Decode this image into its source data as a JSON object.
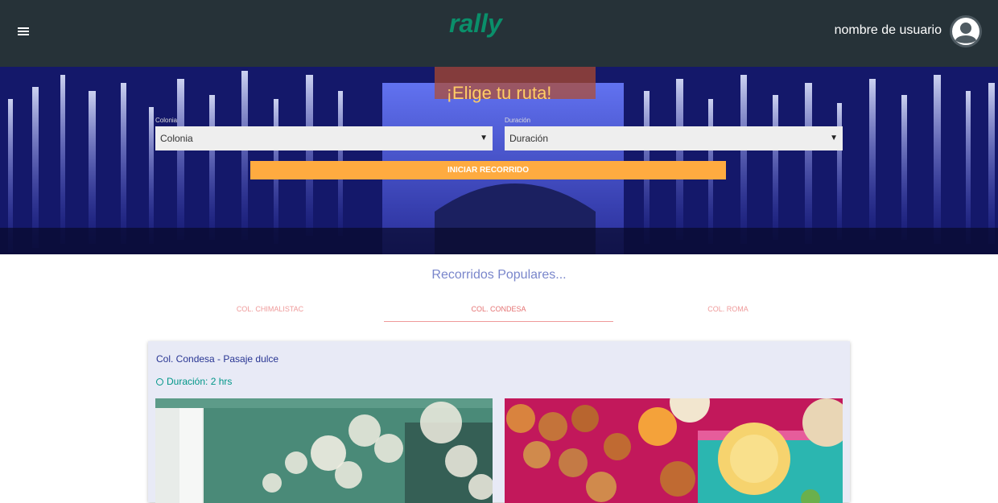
{
  "header": {
    "logo_text": "rally",
    "username": "nombre de usuario",
    "colors": {
      "bar": "#263238",
      "logo": "#0a8f6a"
    }
  },
  "hero": {
    "title": "¡Elige tu ruta!",
    "colonia": {
      "label": "Colonia",
      "value": "Colonia"
    },
    "duracion": {
      "label": "Duración",
      "value": "Duración"
    },
    "start_button": "INICIAR RECORRIDO",
    "colors": {
      "button": "#ffab40",
      "title": "#ffcc66"
    }
  },
  "popular": {
    "title": "Recorridos Populares...",
    "tabs": [
      {
        "label": "COL. CHIMALISTAC",
        "active": false
      },
      {
        "label": "COL. CONDESA",
        "active": true
      },
      {
        "label": "COL. ROMA",
        "active": false
      }
    ]
  },
  "card": {
    "title": "Col. Condesa - Pasaje dulce",
    "duration": "Duración: 2 hrs"
  },
  "icons": [
    "menu-icon",
    "avatar-icon",
    "caret-down-icon",
    "clock-icon"
  ]
}
